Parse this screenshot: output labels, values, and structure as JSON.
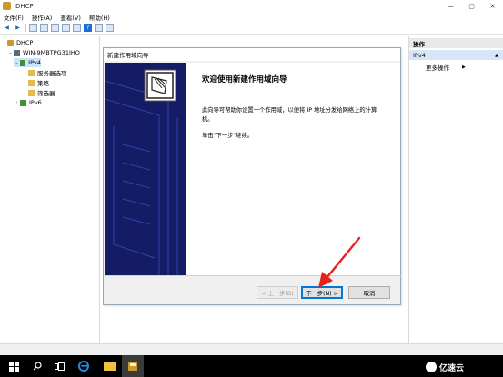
{
  "window": {
    "title": "DHCP",
    "controls": {
      "minimize": "—",
      "maximize": "▢",
      "close": "✕"
    }
  },
  "menu": {
    "items": [
      "文件(F)",
      "操作(A)",
      "查看(V)",
      "帮助(H)"
    ]
  },
  "toolbar": {
    "buttons": [
      "back-icon",
      "forward-icon",
      "up-folder-icon",
      "show-tree-icon",
      "properties-icon",
      "refresh-icon",
      "export-icon",
      "help-icon",
      "console-view-icon",
      "computer-icon"
    ]
  },
  "tree": {
    "nodes": [
      {
        "label": "DHCP",
        "icon": "dhcp-icon"
      },
      {
        "label": "WIN-9MBTPG31IHO",
        "icon": "server-icon"
      },
      {
        "label": "IPv4",
        "icon": "ipv4-icon"
      },
      {
        "label": "服务器选项",
        "icon": "folder-icon"
      },
      {
        "label": "策略",
        "icon": "folder-icon"
      },
      {
        "label": "筛选器",
        "icon": "folder-icon"
      },
      {
        "label": "IPv6",
        "icon": "ipv6-icon"
      }
    ]
  },
  "wizard": {
    "title": "新建作用域向导",
    "heading": "欢迎使用新建作用域向导",
    "description": "此向导可帮助你设置一个作用域，以便将 IP 地址分发给网络上的计算机。",
    "hint": "单击\"下一步\"继续。",
    "buttons": {
      "back": "< 上一步(B)",
      "next": "下一步(N) >",
      "cancel": "取消"
    }
  },
  "actions": {
    "header": "操作",
    "group": "IPv4",
    "more": "更多操作"
  },
  "watermark": {
    "text": "亿速云"
  },
  "colors": {
    "banner": "#141c66",
    "selection": "#cce4f7",
    "accent": "#0078d7",
    "annotation_arrow": "#e8221b"
  }
}
